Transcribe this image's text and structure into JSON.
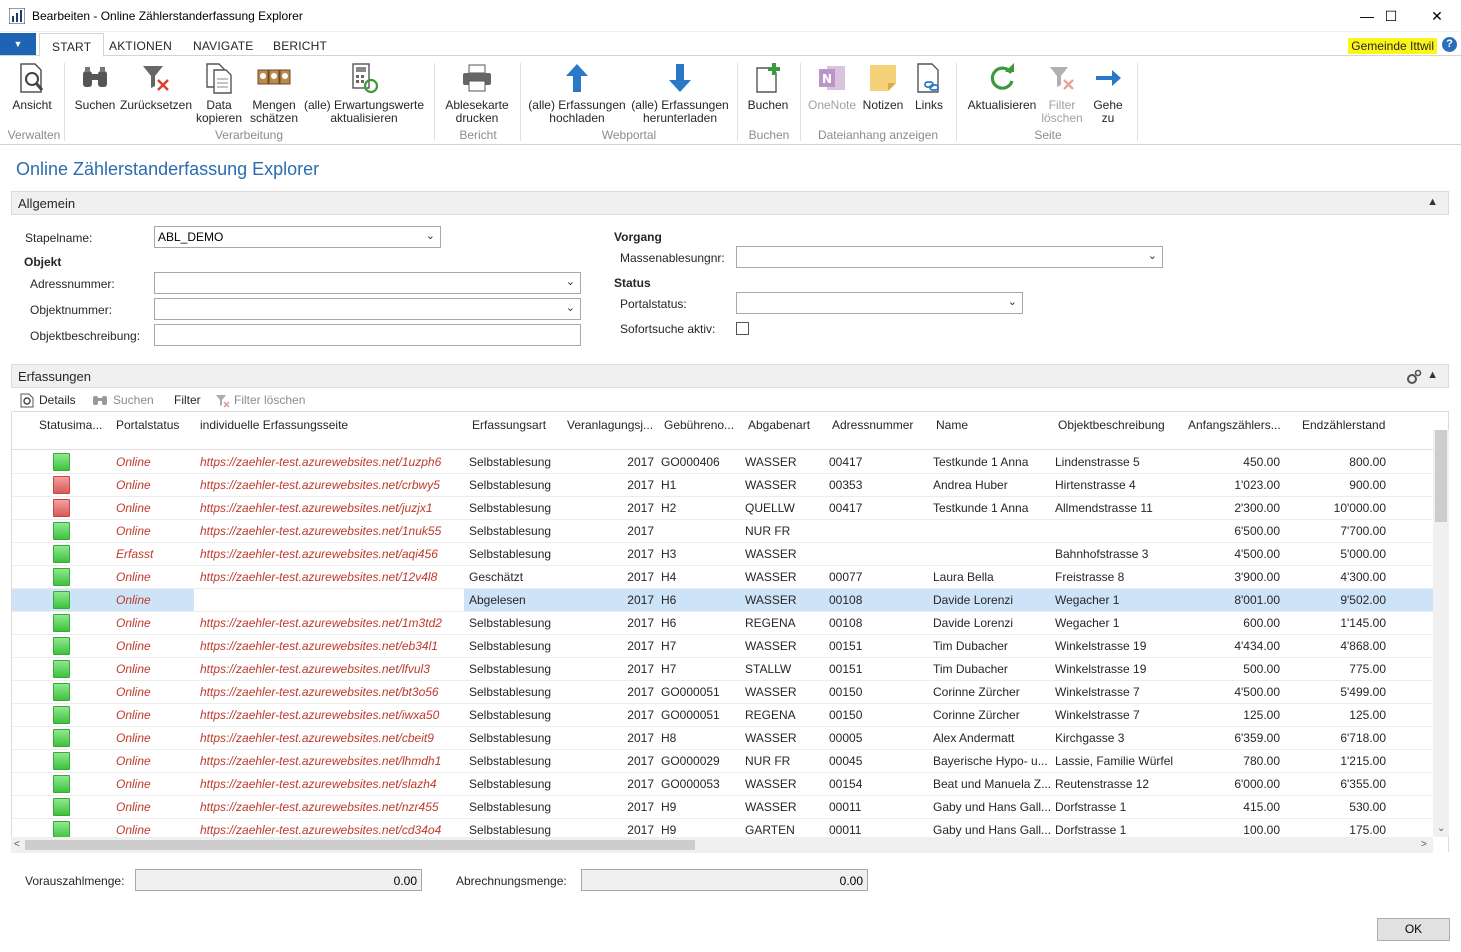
{
  "window": {
    "title": "Bearbeiten - Online Zählerstanderfassung Explorer",
    "minimize": "—",
    "maximize": "☐",
    "close": "✕"
  },
  "tabs": [
    "START",
    "AKTIONEN",
    "NAVIGATE",
    "BERICHT"
  ],
  "company": "Gemeinde Ittwil",
  "help": "?",
  "appmenu": "▼",
  "ribbon": {
    "buttons": {
      "ansicht": "Ansicht",
      "suchen": "Suchen",
      "zuruecksetzen": "Zurücksetzen",
      "data_kopieren_1": "Data",
      "data_kopieren_2": "kopieren",
      "mengen_1": "Mengen",
      "mengen_2": "schätzen",
      "erwartung_1": "(alle) Erwartungswerte",
      "erwartung_2": "aktualisieren",
      "ablesekarte_1": "Ablesekarte",
      "ablesekarte_2": "drucken",
      "hochladen_1": "(alle) Erfassungen",
      "hochladen_2": "hochladen",
      "herunterladen_1": "(alle) Erfassungen",
      "herunterladen_2": "herunterladen",
      "buchen": "Buchen",
      "onenote": "OneNote",
      "notizen": "Notizen",
      "links": "Links",
      "aktualisieren": "Aktualisieren",
      "filter_loeschen_1": "Filter",
      "filter_loeschen_2": "löschen",
      "gehe_zu_1": "Gehe",
      "gehe_zu_2": "zu"
    },
    "groups": {
      "verwalten": "Verwalten",
      "verarbeitung": "Verarbeitung",
      "bericht": "Bericht",
      "webportal": "Webportal",
      "buchen": "Buchen",
      "dateianhang": "Dateianhang anzeigen",
      "seite": "Seite"
    }
  },
  "page_title": "Online Zählerstanderfassung Explorer",
  "allgemein": {
    "header": "Allgemein",
    "stapelname_label": "Stapelname:",
    "stapelname_value": "ABL_DEMO",
    "objekt_header": "Objekt",
    "adressnummer_label": "Adressnummer:",
    "objektnummer_label": "Objektnummer:",
    "objektbeschreibung_label": "Objektbeschreibung:",
    "vorgang_header": "Vorgang",
    "massenablesungnr_label": "Massenablesungnr:",
    "status_header": "Status",
    "portalstatus_label": "Portalstatus:",
    "sofortsuche_label": "Sofortsuche aktiv:"
  },
  "erfassungen": {
    "header": "Erfassungen",
    "toolbar": {
      "details": "Details",
      "suchen": "Suchen",
      "filter": "Filter",
      "filter_loeschen": "Filter löschen"
    },
    "columns": [
      "Statusima...",
      "Portalstatus",
      "individuelle Erfassungsseite",
      "Erfassungsart",
      "Veranlagungsj...",
      "Gebühreno...",
      "Abgabenart",
      "Adressnummer",
      "Name",
      "Objektbeschreibung",
      "Anfangszählers...",
      "Endzählerstand"
    ],
    "rows": [
      {
        "status": "green",
        "portal": "Online",
        "url": "https://zaehler-test.azurewebsites.net/1uzph6",
        "art": "Selbstablesung",
        "jahr": "2017",
        "gebuehr": "GO000406",
        "abgabe": "WASSER",
        "adr": "00417",
        "name": "Testkunde 1 Anna",
        "objekt": "Lindenstrasse 5",
        "anfang": "450.00",
        "ende": "800.00"
      },
      {
        "status": "red",
        "portal": "Online",
        "url": "https://zaehler-test.azurewebsites.net/crbwy5",
        "art": "Selbstablesung",
        "jahr": "2017",
        "gebuehr": "H1",
        "abgabe": "WASSER",
        "adr": "00353",
        "name": "Andrea Huber",
        "objekt": "Hirtenstrasse 4",
        "anfang": "1'023.00",
        "ende": "900.00"
      },
      {
        "status": "red",
        "portal": "Online",
        "url": "https://zaehler-test.azurewebsites.net/juzjx1",
        "art": "Selbstablesung",
        "jahr": "2017",
        "gebuehr": "H2",
        "abgabe": "QUELLW",
        "adr": "00417",
        "name": "Testkunde 1 Anna",
        "objekt": "Allmendstrasse 11",
        "anfang": "2'300.00",
        "ende": "10'000.00"
      },
      {
        "status": "green",
        "portal": "Online",
        "url": "https://zaehler-test.azurewebsites.net/1nuk55",
        "art": "Selbstablesung",
        "jahr": "2017",
        "gebuehr": "",
        "abgabe": "NUR FR",
        "adr": "",
        "name": "",
        "objekt": "",
        "anfang": "6'500.00",
        "ende": "7'700.00"
      },
      {
        "status": "green",
        "portal": "Erfasst",
        "url": "https://zaehler-test.azurewebsites.net/aqi456",
        "art": "Selbstablesung",
        "jahr": "2017",
        "gebuehr": "H3",
        "abgabe": "WASSER",
        "adr": "",
        "name": "",
        "objekt": "Bahnhofstrasse 3",
        "anfang": "4'500.00",
        "ende": "5'000.00"
      },
      {
        "status": "green",
        "portal": "Online",
        "url": "https://zaehler-test.azurewebsites.net/12v4l8",
        "art": "Geschätzt",
        "jahr": "2017",
        "gebuehr": "H4",
        "abgabe": "WASSER",
        "adr": "00077",
        "name": "Laura Bella",
        "objekt": "Freistrasse 8",
        "anfang": "3'900.00",
        "ende": "4'300.00"
      },
      {
        "status": "green",
        "portal": "Online",
        "url": "",
        "art": "Abgelesen",
        "jahr": "2017",
        "gebuehr": "H6",
        "abgabe": "WASSER",
        "adr": "00108",
        "name": "Davide Lorenzi",
        "objekt": "Wegacher 1",
        "anfang": "8'001.00",
        "ende": "9'502.00",
        "selected": true
      },
      {
        "status": "green",
        "portal": "Online",
        "url": "https://zaehler-test.azurewebsites.net/1m3td2",
        "art": "Selbstablesung",
        "jahr": "2017",
        "gebuehr": "H6",
        "abgabe": "REGENA",
        "adr": "00108",
        "name": "Davide Lorenzi",
        "objekt": "Wegacher 1",
        "anfang": "600.00",
        "ende": "1'145.00"
      },
      {
        "status": "green",
        "portal": "Online",
        "url": "https://zaehler-test.azurewebsites.net/eb34l1",
        "art": "Selbstablesung",
        "jahr": "2017",
        "gebuehr": "H7",
        "abgabe": "WASSER",
        "adr": "00151",
        "name": "Tim Dubacher",
        "objekt": "Winkelstrasse 19",
        "anfang": "4'434.00",
        "ende": "4'868.00"
      },
      {
        "status": "green",
        "portal": "Online",
        "url": "https://zaehler-test.azurewebsites.net/lfvul3",
        "art": "Selbstablesung",
        "jahr": "2017",
        "gebuehr": "H7",
        "abgabe": "STALLW",
        "adr": "00151",
        "name": "Tim Dubacher",
        "objekt": "Winkelstrasse 19",
        "anfang": "500.00",
        "ende": "775.00"
      },
      {
        "status": "green",
        "portal": "Online",
        "url": "https://zaehler-test.azurewebsites.net/bt3o56",
        "art": "Selbstablesung",
        "jahr": "2017",
        "gebuehr": "GO000051",
        "abgabe": "WASSER",
        "adr": "00150",
        "name": "Corinne Zürcher",
        "objekt": "Winkelstrasse 7",
        "anfang": "4'500.00",
        "ende": "5'499.00"
      },
      {
        "status": "green",
        "portal": "Online",
        "url": "https://zaehler-test.azurewebsites.net/iwxa50",
        "art": "Selbstablesung",
        "jahr": "2017",
        "gebuehr": "GO000051",
        "abgabe": "REGENA",
        "adr": "00150",
        "name": "Corinne Zürcher",
        "objekt": "Winkelstrasse 7",
        "anfang": "125.00",
        "ende": "125.00"
      },
      {
        "status": "green",
        "portal": "Online",
        "url": "https://zaehler-test.azurewebsites.net/cbeit9",
        "art": "Selbstablesung",
        "jahr": "2017",
        "gebuehr": "H8",
        "abgabe": "WASSER",
        "adr": "00005",
        "name": "Alex Andermatt",
        "objekt": "Kirchgasse 3",
        "anfang": "6'359.00",
        "ende": "6'718.00"
      },
      {
        "status": "green",
        "portal": "Online",
        "url": "https://zaehler-test.azurewebsites.net/lhmdh1",
        "art": "Selbstablesung",
        "jahr": "2017",
        "gebuehr": "GO000029",
        "abgabe": "NUR FR",
        "adr": "00045",
        "name": "Bayerische Hypo- u...",
        "objekt": "Lassie, Familie Würfel",
        "anfang": "780.00",
        "ende": "1'215.00"
      },
      {
        "status": "green",
        "portal": "Online",
        "url": "https://zaehler-test.azurewebsites.net/slazh4",
        "art": "Selbstablesung",
        "jahr": "2017",
        "gebuehr": "GO000053",
        "abgabe": "WASSER",
        "adr": "00154",
        "name": "Beat und Manuela Z...",
        "objekt": "Reutenstrasse 12",
        "anfang": "6'000.00",
        "ende": "6'355.00"
      },
      {
        "status": "green",
        "portal": "Online",
        "url": "https://zaehler-test.azurewebsites.net/nzr455",
        "art": "Selbstablesung",
        "jahr": "2017",
        "gebuehr": "H9",
        "abgabe": "WASSER",
        "adr": "00011",
        "name": "Gaby und Hans Gall...",
        "objekt": "Dorfstrasse 1",
        "anfang": "415.00",
        "ende": "530.00"
      },
      {
        "status": "green",
        "portal": "Online",
        "url": "https://zaehler-test.azurewebsites.net/cd34o4",
        "art": "Selbstablesung",
        "jahr": "2017",
        "gebuehr": "H9",
        "abgabe": "GARTEN",
        "adr": "00011",
        "name": "Gaby und Hans Gall...",
        "objekt": "Dorfstrasse 1",
        "anfang": "100.00",
        "ende": "175.00"
      }
    ]
  },
  "footer": {
    "vorauszahl_label": "Vorauszahlmenge:",
    "vorauszahl_value": "0.00",
    "abrechnung_label": "Abrechnungsmenge:",
    "abrechnung_value": "0.00",
    "ok": "OK"
  }
}
